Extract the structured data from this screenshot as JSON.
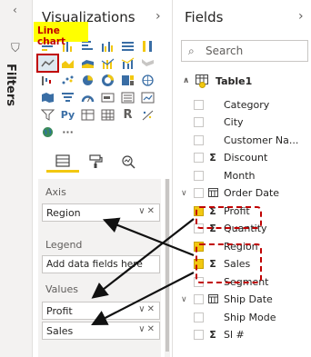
{
  "filters_strip": {
    "label": "Filters"
  },
  "visualizations": {
    "title": "Visualizations",
    "tooltip": "Line chart",
    "wells": {
      "axis": {
        "label": "Axis",
        "value": "Region"
      },
      "legend": {
        "label": "Legend",
        "placeholder": "Add data fields here"
      },
      "values": {
        "label": "Values",
        "items": [
          "Profit",
          "Sales"
        ]
      }
    }
  },
  "fields_pane": {
    "title": "Fields",
    "search_placeholder": "Search",
    "table": "Table1",
    "fields": [
      {
        "name": "Category",
        "type": "",
        "checked": false
      },
      {
        "name": "City",
        "type": "",
        "checked": false
      },
      {
        "name": "Customer Na...",
        "type": "",
        "checked": false
      },
      {
        "name": "Discount",
        "type": "Σ",
        "checked": false
      },
      {
        "name": "Month",
        "type": "",
        "checked": false
      },
      {
        "name": "Order Date",
        "type": "calendar",
        "checked": false,
        "expandable": true
      },
      {
        "name": "Profit",
        "type": "Σ",
        "checked": true,
        "highlighted": true
      },
      {
        "name": "Quantity",
        "type": "Σ",
        "checked": false
      },
      {
        "name": "Region",
        "type": "",
        "checked": true,
        "highlighted": true
      },
      {
        "name": "Sales",
        "type": "Σ",
        "checked": true,
        "highlighted": true
      },
      {
        "name": "Segment",
        "type": "",
        "checked": false
      },
      {
        "name": "Ship Date",
        "type": "calendar",
        "checked": false,
        "expandable": true
      },
      {
        "name": "Ship Mode",
        "type": "",
        "checked": false
      },
      {
        "name": "Sl #",
        "type": "Σ",
        "checked": false
      }
    ]
  },
  "colors": {
    "accent": "#f2c811",
    "highlight": "#c00000",
    "tooltip_bg": "#ffff00"
  }
}
